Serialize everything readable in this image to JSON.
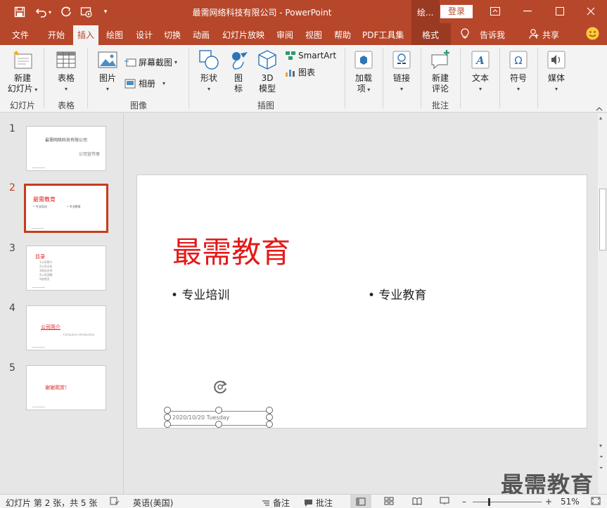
{
  "titlebar": {
    "title": "最需网络科技有限公司  -  PowerPoint",
    "context_tab": "绘...",
    "login_label": "登录"
  },
  "tabs": [
    "文件",
    "开始",
    "插入",
    "绘图",
    "设计",
    "切换",
    "动画",
    "幻灯片放映",
    "审阅",
    "视图",
    "帮助",
    "PDF工具集",
    "格式"
  ],
  "active_tab": "插入",
  "tell_me": "告诉我",
  "share": "共享",
  "ribbon": {
    "new_slide": [
      "新建",
      "幻灯片"
    ],
    "table": "表格",
    "picture": "图片",
    "screenshot": "屏幕截图",
    "album": "相册",
    "shapes": "形状",
    "icons": [
      "图",
      "标"
    ],
    "model3d": [
      "3D",
      "模型"
    ],
    "smartart": "SmartArt",
    "chart": "图表",
    "addins": [
      "加载",
      "项"
    ],
    "link": "链接",
    "new_comment": [
      "新建",
      "评论"
    ],
    "text": "文本",
    "symbol": "符号",
    "media": "媒体",
    "groups": {
      "slides": "幻灯片",
      "tables": "表格",
      "images": "图像",
      "illustrations": "插图",
      "comments": "批注"
    }
  },
  "thumbnails": [
    {
      "num": "1",
      "title": "最需网络科技有限公司",
      "sub": "公司宣传册"
    },
    {
      "num": "2",
      "title": "最需教育",
      "sub1": "• 专业培训",
      "sub2": "• 专业教育"
    },
    {
      "num": "3",
      "title": "目录",
      "items": [
        "1公司简介",
        "2公司文化",
        "3网站支持",
        "4公司战略",
        "5结束页"
      ]
    },
    {
      "num": "4",
      "title": "公司简介",
      "sub": "Company  introduction"
    },
    {
      "num": "5",
      "title": "谢谢观赏！"
    }
  ],
  "slide": {
    "title": "最需教育",
    "bullet1": "• 专业培训",
    "bullet2": "• 专业教育",
    "date": "2020/10/20 Tuesday"
  },
  "watermark": "最需教育",
  "statusbar": {
    "slide_info": "幻灯片 第 2 张，共 5 张",
    "language": "英语(美国)",
    "notes": "备注",
    "comments": "批注",
    "zoom": "51%"
  },
  "colors": {
    "accent": "#b7472a",
    "title_red": "#e31a1a",
    "selection": "#c43e1c"
  }
}
